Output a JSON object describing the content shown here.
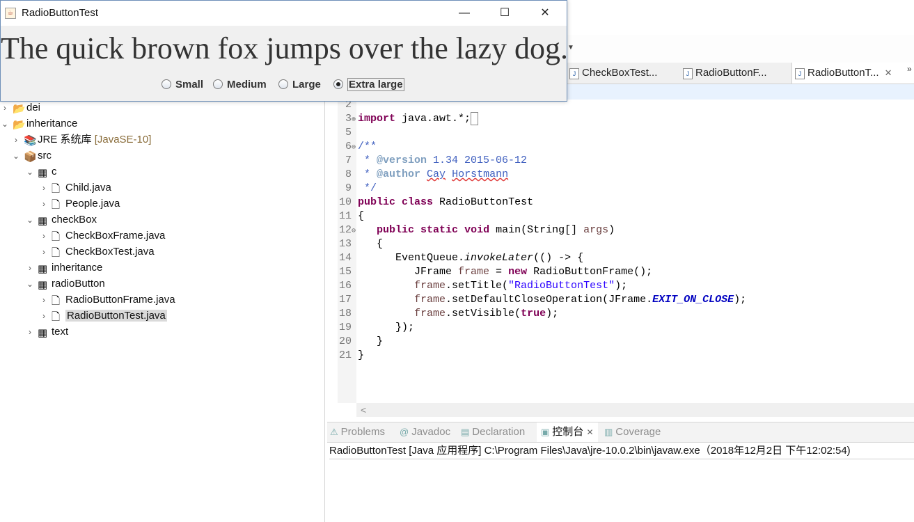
{
  "swing_window": {
    "title": "RadioButtonTest",
    "controls": {
      "minimize": "—",
      "maximize": "☐",
      "close": "✕"
    },
    "sample_text": "The quick brown fox jumps over the lazy dog.",
    "radios": [
      {
        "label": "Small",
        "checked": false
      },
      {
        "label": "Medium",
        "checked": false
      },
      {
        "label": "Large",
        "checked": false
      },
      {
        "label": "Extra large",
        "checked": true
      }
    ]
  },
  "editor_tabs": [
    {
      "label": "CheckBoxTest...",
      "active": false
    },
    {
      "label": "RadioButtonF...",
      "active": false
    },
    {
      "label": "RadioButtonT...",
      "active": true,
      "close": "✕"
    }
  ],
  "tabs_overflow": "»",
  "explorer": {
    "items": [
      {
        "label": "dei",
        "icon": "project-icon"
      },
      {
        "label": "inheritance",
        "icon": "project-icon"
      },
      {
        "label": "JRE 系统库",
        "decorator": "[JavaSE-10]",
        "icon": "library-icon"
      },
      {
        "label": "src",
        "icon": "source-folder-icon"
      },
      {
        "label": "c",
        "icon": "package-icon"
      },
      {
        "label": "Child.java",
        "icon": "java-file-icon"
      },
      {
        "label": "People.java",
        "icon": "java-file-icon"
      },
      {
        "label": "checkBox",
        "icon": "package-icon"
      },
      {
        "label": "CheckBoxFrame.java",
        "icon": "java-file-icon"
      },
      {
        "label": "CheckBoxTest.java",
        "icon": "java-file-icon"
      },
      {
        "label": "inheritance",
        "icon": "package-icon"
      },
      {
        "label": "radioButton",
        "icon": "package-icon"
      },
      {
        "label": "RadioButtonFrame.java",
        "icon": "java-file-icon"
      },
      {
        "label": "RadioButtonTest.java",
        "icon": "java-file-icon",
        "selected": true
      },
      {
        "label": "text",
        "icon": "package-icon"
      }
    ]
  },
  "code": {
    "line_numbers": [
      "2",
      "3",
      "5",
      "6",
      "7",
      "8",
      "9",
      "10",
      "11",
      "12",
      "13",
      "14",
      "15",
      "16",
      "17",
      "18",
      "19",
      "20",
      "21"
    ]
  },
  "bottom_tabs": [
    {
      "label": "Problems",
      "active": false
    },
    {
      "label": "Javadoc",
      "active": false
    },
    {
      "label": "Declaration",
      "active": false
    },
    {
      "label": "控制台",
      "active": true,
      "close": "✕"
    },
    {
      "label": "Coverage",
      "active": false
    }
  ],
  "console_title": "RadioButtonTest [Java 应用程序] C:\\Program Files\\Java\\jre-10.0.2\\bin\\javaw.exe（2018年12月2日 下午12:02:54)",
  "colors": {
    "keyword": "#7f0055",
    "comment": "#3f5fbf",
    "string": "#2a00ff",
    "static_field": "#0000c0",
    "selection": "#dadada"
  }
}
